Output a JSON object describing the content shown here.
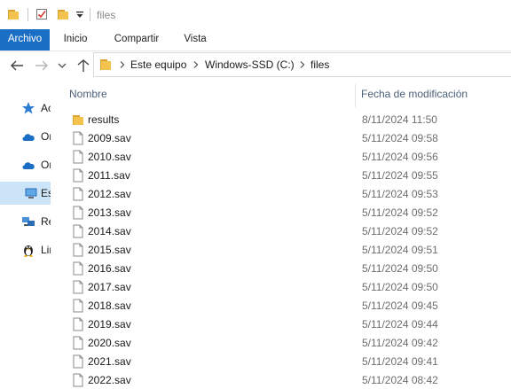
{
  "window": {
    "title": "files"
  },
  "ribbon": {
    "tabs": [
      "Archivo",
      "Inicio",
      "Compartir",
      "Vista"
    ]
  },
  "address": {
    "breadcrumb": [
      "Este equipo",
      "Windows-SSD (C:)",
      "files"
    ]
  },
  "sidebar": {
    "items": [
      {
        "label": "Acceso rápido",
        "icon": "star-icon"
      },
      {
        "label": "OneDrive",
        "icon": "cloud-icon"
      },
      {
        "label": "OneDrive",
        "icon": "cloud-icon"
      },
      {
        "label": "Este equipo",
        "icon": "computer-icon",
        "selected": true
      },
      {
        "label": "Red",
        "icon": "network-icon"
      },
      {
        "label": "Linux",
        "icon": "linux-icon"
      }
    ]
  },
  "columns": {
    "name": "Nombre",
    "date": "Fecha de modificación"
  },
  "files": [
    {
      "name": "results",
      "date": "8/11/2024 11:50",
      "type": "folder"
    },
    {
      "name": "2009.sav",
      "date": "5/11/2024 09:58",
      "type": "file"
    },
    {
      "name": "2010.sav",
      "date": "5/11/2024 09:56",
      "type": "file"
    },
    {
      "name": "2011.sav",
      "date": "5/11/2024 09:55",
      "type": "file"
    },
    {
      "name": "2012.sav",
      "date": "5/11/2024 09:53",
      "type": "file"
    },
    {
      "name": "2013.sav",
      "date": "5/11/2024 09:52",
      "type": "file"
    },
    {
      "name": "2014.sav",
      "date": "5/11/2024 09:52",
      "type": "file"
    },
    {
      "name": "2015.sav",
      "date": "5/11/2024 09:51",
      "type": "file"
    },
    {
      "name": "2016.sav",
      "date": "5/11/2024 09:50",
      "type": "file"
    },
    {
      "name": "2017.sav",
      "date": "5/11/2024 09:50",
      "type": "file"
    },
    {
      "name": "2018.sav",
      "date": "5/11/2024 09:45",
      "type": "file"
    },
    {
      "name": "2019.sav",
      "date": "5/11/2024 09:44",
      "type": "file"
    },
    {
      "name": "2020.sav",
      "date": "5/11/2024 09:42",
      "type": "file"
    },
    {
      "name": "2021.sav",
      "date": "5/11/2024 09:41",
      "type": "file"
    },
    {
      "name": "2022.sav",
      "date": "5/11/2024 08:42",
      "type": "file"
    }
  ],
  "colors": {
    "accent": "#1a6fc4",
    "selection": "#cce4f7",
    "folder": "#e8b03c"
  }
}
